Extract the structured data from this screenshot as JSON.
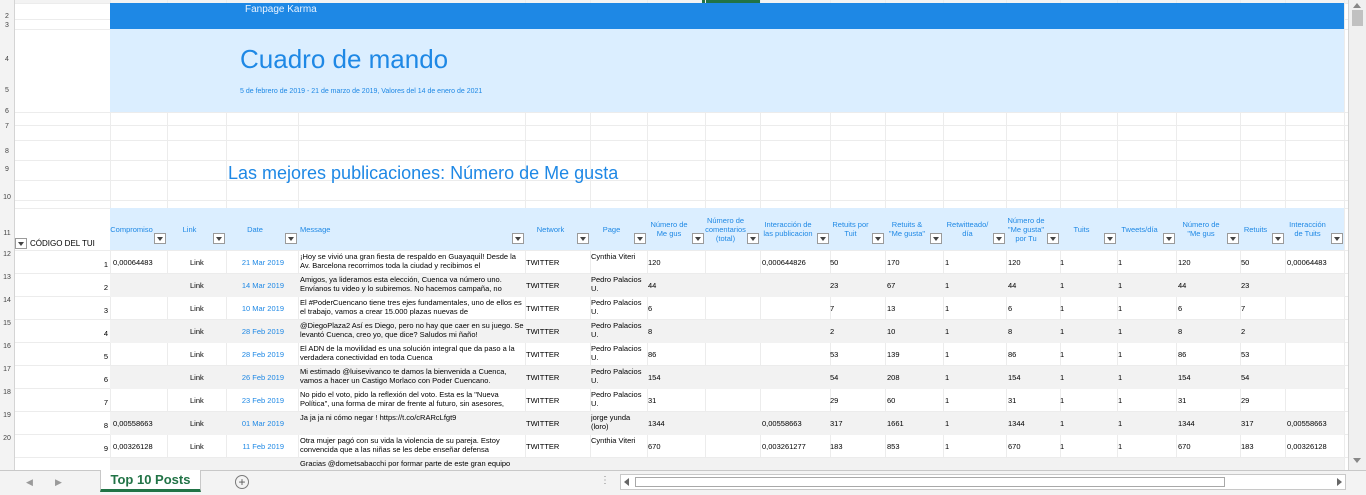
{
  "banner": {
    "title": "Fanpage Karma"
  },
  "hero": {
    "title": "Cuadro de mando",
    "subtitle": "5 de febrero de 2019 - 21 de marzo de 2019, Valores del 14 de enero de 2021"
  },
  "section_title": "Las mejores publicaciones: Número de Me gusta",
  "a11_label": "CÓDIGO DEL TUI",
  "row_numbers": [
    "2",
    "3",
    "4",
    "5",
    "6",
    "7",
    "8",
    "9",
    "10",
    "11",
    "12",
    "13",
    "14",
    "15",
    "16",
    "17",
    "18",
    "19",
    "20"
  ],
  "headers": [
    "Compromiso",
    "Link",
    "Date",
    "Message",
    "Network",
    "Page",
    "Número de Me gus",
    "Número de comentarios (total)",
    "Interacción de las publicacion",
    "Retuits por Tuit",
    "Retuits & \"Me gusta\"",
    "Retwitteado/ día",
    "Número de \"Me gusta\" por Tu",
    "Tuits",
    "Tweets/día",
    "Número de \"Me gus",
    "Retuits",
    "Interacción de Tuits"
  ],
  "rows": [
    {
      "idx": "1",
      "compromiso": "0,00064483",
      "link": "Link",
      "date": "21 Mar 2019",
      "message": "¡Hoy se vivió una gran fiesta de respaldo en Guayaquil! Desde la Av. Barcelona recorrimos toda la ciudad y recibimos el",
      "network": "TWITTER",
      "page": "Cynthia Viteri",
      "likes": "120",
      "comments": "",
      "interaccion": "0,000644826",
      "retuits_tuit": "50",
      "retuits_mg": "170",
      "retw_dia": "1",
      "mg_tuit": "120",
      "tuits": "1",
      "tweets_dia": "1",
      "num_mg": "120",
      "retuits": "50",
      "interaccion_tuits": "0,00064483"
    },
    {
      "idx": "2",
      "compromiso": "",
      "link": "Link",
      "date": "14 Mar 2019",
      "message": "Amigos, ya lideramos esta elección, Cuenca va número uno. Envíanos tu video y lo subiremos. No hacemos campaña, no",
      "network": "TWITTER",
      "page": "Pedro Palacios U.",
      "likes": "44",
      "comments": "",
      "interaccion": "",
      "retuits_tuit": "23",
      "retuits_mg": "67",
      "retw_dia": "1",
      "mg_tuit": "44",
      "tuits": "1",
      "tweets_dia": "1",
      "num_mg": "44",
      "retuits": "23",
      "interaccion_tuits": ""
    },
    {
      "idx": "3",
      "compromiso": "",
      "link": "Link",
      "date": "10 Mar 2019",
      "message": "El #PoderCuencano tiene tres ejes fundamentales, uno de ellos es el trabajo, vamos a crear 15.000 plazas nuevas de",
      "network": "TWITTER",
      "page": "Pedro Palacios U.",
      "likes": "6",
      "comments": "",
      "interaccion": "",
      "retuits_tuit": "7",
      "retuits_mg": "13",
      "retw_dia": "1",
      "mg_tuit": "6",
      "tuits": "1",
      "tweets_dia": "1",
      "num_mg": "6",
      "retuits": "7",
      "interaccion_tuits": ""
    },
    {
      "idx": "4",
      "compromiso": "",
      "link": "Link",
      "date": "28 Feb 2019",
      "message": "@DiegoPlaza2 Así es Diego, pero no hay que caer en su juego. Se levantó Cuenca, creo yo, que dice? Saludos mi ñaño!",
      "network": "TWITTER",
      "page": "Pedro Palacios U.",
      "likes": "8",
      "comments": "",
      "interaccion": "",
      "retuits_tuit": "2",
      "retuits_mg": "10",
      "retw_dia": "1",
      "mg_tuit": "8",
      "tuits": "1",
      "tweets_dia": "1",
      "num_mg": "8",
      "retuits": "2",
      "interaccion_tuits": ""
    },
    {
      "idx": "5",
      "compromiso": "",
      "link": "Link",
      "date": "28 Feb 2019",
      "message": "El ADN de la movilidad es una solución integral que da paso a la verdadera conectividad en toda Cuenca",
      "network": "TWITTER",
      "page": "Pedro Palacios U.",
      "likes": "86",
      "comments": "",
      "interaccion": "",
      "retuits_tuit": "53",
      "retuits_mg": "139",
      "retw_dia": "1",
      "mg_tuit": "86",
      "tuits": "1",
      "tweets_dia": "1",
      "num_mg": "86",
      "retuits": "53",
      "interaccion_tuits": ""
    },
    {
      "idx": "6",
      "compromiso": "",
      "link": "Link",
      "date": "26 Feb 2019",
      "message": "Mi estimado @luisevivanco te damos la bienvenida a Cuenca, vamos a hacer un Castigo Morlaco con Poder Cuencano.",
      "network": "TWITTER",
      "page": "Pedro Palacios U.",
      "likes": "154",
      "comments": "",
      "interaccion": "",
      "retuits_tuit": "54",
      "retuits_mg": "208",
      "retw_dia": "1",
      "mg_tuit": "154",
      "tuits": "1",
      "tweets_dia": "1",
      "num_mg": "154",
      "retuits": "54",
      "interaccion_tuits": ""
    },
    {
      "idx": "7",
      "compromiso": "",
      "link": "Link",
      "date": "23 Feb 2019",
      "message": "No pido el voto, pido la reflexión del voto. Esta es la \"Nueva Política\", una forma de mirar de frente al futuro, sin asesores,",
      "network": "TWITTER",
      "page": "Pedro Palacios U.",
      "likes": "31",
      "comments": "",
      "interaccion": "",
      "retuits_tuit": "29",
      "retuits_mg": "60",
      "retw_dia": "1",
      "mg_tuit": "31",
      "tuits": "1",
      "tweets_dia": "1",
      "num_mg": "31",
      "retuits": "29",
      "interaccion_tuits": ""
    },
    {
      "idx": "8",
      "compromiso": "0,00558663",
      "link": "Link",
      "date": "01 Mar 2019",
      "message": "Ja ja ja ni cómo negar ! https://t.co/cRARcLfgt9",
      "network": "TWITTER",
      "page": "jorge yunda (loro)",
      "likes": "1344",
      "comments": "",
      "interaccion": "0,00558663",
      "retuits_tuit": "317",
      "retuits_mg": "1661",
      "retw_dia": "1",
      "mg_tuit": "1344",
      "tuits": "1",
      "tweets_dia": "1",
      "num_mg": "1344",
      "retuits": "317",
      "interaccion_tuits": "0,00558663"
    },
    {
      "idx": "9",
      "compromiso": "0,00326128",
      "link": "Link",
      "date": "11 Feb 2019",
      "message": "Otra mujer pagó con su vida la violencia de su pareja. Estoy convencida que a las niñas se les debe enseñar defensa",
      "network": "TWITTER",
      "page": "Cynthia Viteri",
      "likes": "670",
      "comments": "",
      "interaccion": "0,003261277",
      "retuits_tuit": "183",
      "retuits_mg": "853",
      "retw_dia": "1",
      "mg_tuit": "670",
      "tuits": "1",
      "tweets_dia": "1",
      "num_mg": "670",
      "retuits": "183",
      "interaccion_tuits": "0,00326128"
    },
    {
      "idx": "",
      "compromiso": "",
      "link": "",
      "date": "",
      "message": "Gracias @dometsabacchi por formar parte de este gran equipo",
      "network": "",
      "page": "",
      "likes": "",
      "comments": "",
      "interaccion": "",
      "retuits_tuit": "",
      "retuits_mg": "",
      "retw_dia": "",
      "mg_tuit": "",
      "tuits": "",
      "tweets_dia": "",
      "num_mg": "",
      "retuits": "",
      "interaccion_tuits": ""
    }
  ],
  "sheet_tab": "Top 10 Posts",
  "colors": {
    "accent": "#1e88e5",
    "hero_bg": "#dbeeff",
    "tab_green": "#217346"
  }
}
